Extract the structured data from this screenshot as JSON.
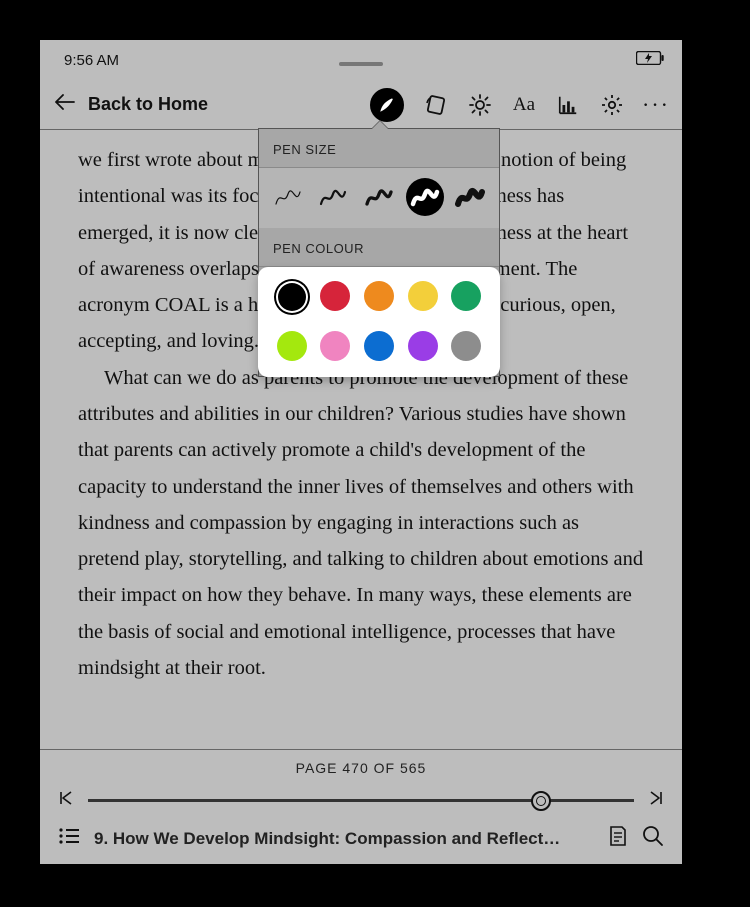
{
  "status": {
    "time": "9:56 AM"
  },
  "toolbar": {
    "back_label": "Back to Home"
  },
  "popover": {
    "pen_size_label": "PEN SIZE",
    "pen_colour_label": "PEN COLOUR",
    "selected_size_index": 3,
    "selected_color_index": 0,
    "colors": [
      "#000000",
      "#d6243a",
      "#ee8a1e",
      "#f3cf3a",
      "#17a160",
      "#a4e80e",
      "#f084c0",
      "#0c6dd1",
      "#9a3de6",
      "#8d8d8d"
    ]
  },
  "page_text": {
    "p1": "we first wrote about mindful parenting, the general notion of being intentional was its focus. As the science of mindfulness has emerged, it is now clear that the presence and openness at the heart of awareness overlaps directly with parental attunement. The acronym COAL is a helpful way to remember this: curious, open, accepting, and loving.",
    "p2": "What can we do as parents to promote the development of these attributes and abilities in our children? Various studies have shown that parents can actively promote a child's development of the capacity to understand the inner lives of themselves and others with kindness and compassion by engaging in interactions such as pretend play, storytelling, and talking to children about emotions and their impact on how they behave. In many ways, these elements are the basis of social and emotional intelligence, processes that have mindsight at their root."
  },
  "footer": {
    "page_label": "PAGE 470 OF 565",
    "current_page": 470,
    "total_pages": 565,
    "progress_percent": 83,
    "chapter_title": "9. How We Develop Mindsight: Compassion and Reflect…"
  }
}
